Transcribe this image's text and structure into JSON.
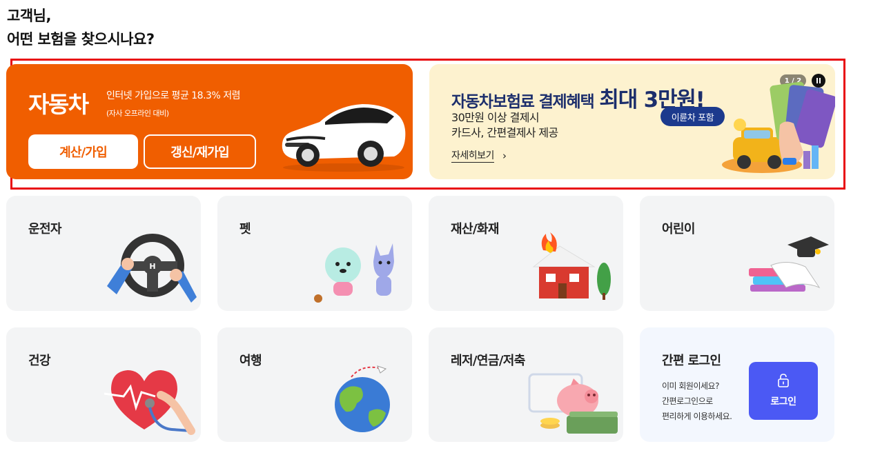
{
  "greeting": {
    "line1": "고객님,",
    "line2": "어떤 보험을 찾으시나요?"
  },
  "car": {
    "title": "자동차",
    "desc": "인터넷 가입으로 평균 18.3% 저렴",
    "sub": "(자사 오프라인 대비)",
    "btn_calc": "계산/가입",
    "btn_renew": "갱신/재가입",
    "colors": {
      "bg": "#f05e00",
      "text": "#ffffff"
    }
  },
  "promo": {
    "title": "자동차보험료 결제혜택",
    "highlight": "최대 3만원!",
    "line1": "30만원 이상 결제시",
    "line2": "카드사, 간편결제사 제공",
    "link": "자세히보기",
    "link_arrow": "›",
    "badge": "이륜차 포함",
    "pager": "1 / 2",
    "pause_icon": "pause-icon",
    "colors": {
      "bg": "#fdf2cf",
      "title": "#1c2e6c",
      "badge": "#1c3a8d"
    }
  },
  "categories": [
    {
      "label": "운전자",
      "icon": "steering-wheel-icon"
    },
    {
      "label": "펫",
      "icon": "pet-icon"
    },
    {
      "label": "재산/화재",
      "icon": "house-fire-icon"
    },
    {
      "label": "어린이",
      "icon": "books-graduation-icon"
    },
    {
      "label": "건강",
      "icon": "heart-stethoscope-icon"
    },
    {
      "label": "여행",
      "icon": "globe-plane-icon"
    },
    {
      "label": "레저/연금/저축",
      "icon": "piggy-bank-icon"
    }
  ],
  "login": {
    "title": "간편 로그인",
    "desc_line1": "이미 회원이세요?",
    "desc_line2": "간편로그인으로",
    "desc_line3": "편리하게 이용하세요.",
    "button": "로그인",
    "icon": "unlock-icon",
    "colors": {
      "button": "#4b59f4"
    }
  }
}
